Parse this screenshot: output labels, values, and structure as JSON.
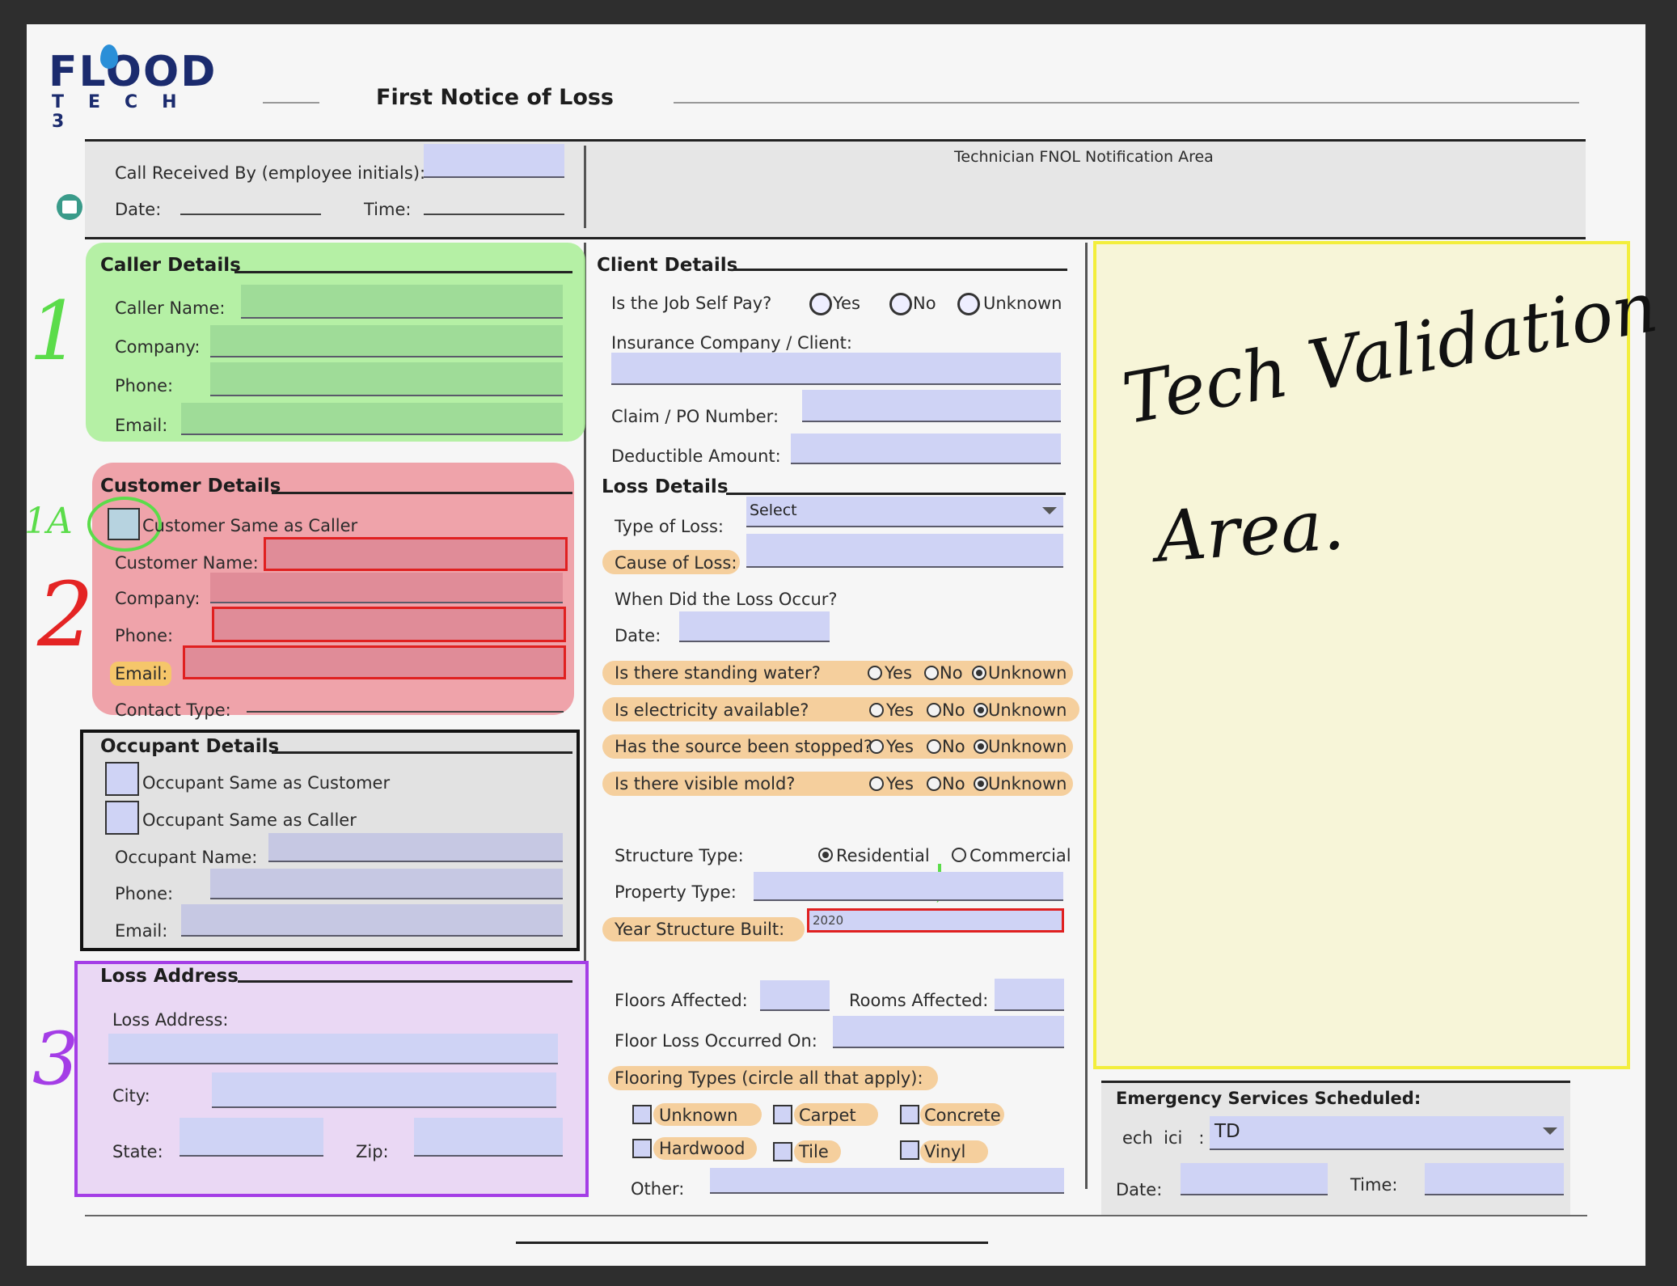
{
  "brand": {
    "logo_top": "FLOOD",
    "logo_bottom": "TECH 3"
  },
  "form_title": "First Notice of Loss",
  "header": {
    "call_received_label": "Call Received By (employee initials):",
    "date_label": "Date:",
    "time_label": "Time:",
    "tech_area_title": "Technician FNOL Notification Area"
  },
  "caller": {
    "title": "Caller Details",
    "name_label": "Caller Name:",
    "company_label": "Company:",
    "phone_label": "Phone:",
    "email_label": "Email:"
  },
  "customer": {
    "title": "Customer Details",
    "same_as_caller": "Customer Same as Caller",
    "name_label": "Customer Name:",
    "company_label": "Company:",
    "phone_label": "Phone:",
    "email_label": "Email:",
    "contact_type_label": "Contact Type:"
  },
  "occupant": {
    "title": "Occupant Details",
    "same_as_customer": "Occupant Same as Customer",
    "same_as_caller": "Occupant Same as Caller",
    "name_label": "Occupant Name:",
    "phone_label": "Phone:",
    "email_label": "Email:"
  },
  "loss_address": {
    "title": "Loss Address",
    "address_label": "Loss Address:",
    "city_label": "City:",
    "state_label": "State:",
    "zip_label": "Zip:"
  },
  "client": {
    "title": "Client Details",
    "self_pay_q": "Is the Job Self Pay?",
    "yes": "Yes",
    "no": "No",
    "unknown": "Unknown",
    "insurance_label": "Insurance Company / Client:",
    "claim_label": "Claim / PO Number:",
    "deductible_label": "Deductible Amount:"
  },
  "loss": {
    "title": "Loss Details",
    "type_label": "Type of Loss:",
    "type_value": "Select",
    "cause_label": "Cause of Loss:",
    "when_label": "When Did the Loss Occur?",
    "date_label": "Date:",
    "q1": "Is there standing water?",
    "q2": "Is electricity available?",
    "q3": "Has the source been stopped?",
    "q4": "Is there visible mold?",
    "yes": "Yes",
    "no": "No",
    "unknown": "Unknown",
    "structure_label": "Structure Type:",
    "residential": "Residential",
    "commercial": "Commercial",
    "property_label": "Property Type:",
    "year_label": "Year Structure Built:",
    "year_value": "2020",
    "floors_label": "Floors Affected:",
    "rooms_label": "Rooms Affected:",
    "floor_loss_label": "Floor Loss Occurred On:",
    "flooring_label": "Flooring Types (circle all that apply):",
    "flooring": [
      "Unknown",
      "Carpet",
      "Concrete",
      "Hardwood",
      "Tile",
      "Vinyl"
    ],
    "other_label": "Other:"
  },
  "emergency": {
    "title": "Emergency Services Scheduled:",
    "tech_label": "ech  ici   :",
    "tech_value": "TD",
    "date_label": "Date:",
    "time_label": "Time:"
  },
  "annotations": {
    "n1": "1",
    "n1a": "1A",
    "n2": "2",
    "n3": "3",
    "tech_validation_line1": "Tech Validation",
    "tech_validation_line2": "Area."
  },
  "colors": {
    "field_fill": "#cfd3f5",
    "caller_highlight": "#a9ee96",
    "customer_highlight": "#ee9aa2",
    "loss_address_border": "#a43de6",
    "tech_area_fill": "#f7f5d8",
    "tech_area_border": "#f3ee3c",
    "orange_highlight": "#f5cf9d",
    "error_border": "#e02020"
  }
}
